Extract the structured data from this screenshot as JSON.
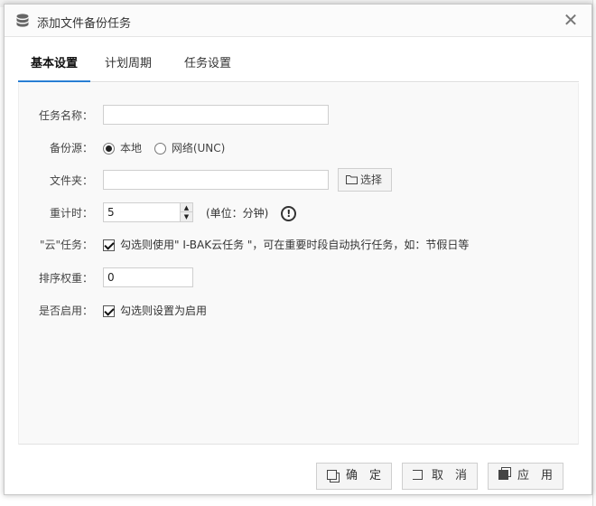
{
  "dialog": {
    "title": "添加文件备份任务",
    "close_symbol": "✕"
  },
  "tabs": [
    {
      "label": "基本设置",
      "active": true
    },
    {
      "label": "计划周期",
      "active": false
    },
    {
      "label": "任务设置",
      "active": false
    }
  ],
  "form": {
    "task_name": {
      "label": "任务名称：",
      "value": ""
    },
    "source": {
      "label": "备份源：",
      "options": [
        {
          "label": "本地",
          "selected": true
        },
        {
          "label": "网络(UNC)",
          "selected": false
        }
      ]
    },
    "folder": {
      "label": "文件夹：",
      "value": "",
      "browse_label": "选择"
    },
    "timer": {
      "label": "重计时：",
      "value": "5",
      "unit": "(单位：分钟)"
    },
    "cloud_task": {
      "label": "\"云\"任务：",
      "checked": true,
      "text": "勾选则使用\" I-BAK云任务 \"，可在重要时段自动执行任务，如：节假日等"
    },
    "sort_weight": {
      "label": "排序权重：",
      "value": "0"
    },
    "enabled": {
      "label": "是否启用：",
      "checked": true,
      "text": "勾选则设置为启用"
    }
  },
  "footer": {
    "confirm_label": "确　定",
    "cancel_label": "取　消",
    "apply_label": "应　用"
  },
  "colors": {
    "accent": "#2a7fd4",
    "content_bg": "#f9f9f9"
  }
}
